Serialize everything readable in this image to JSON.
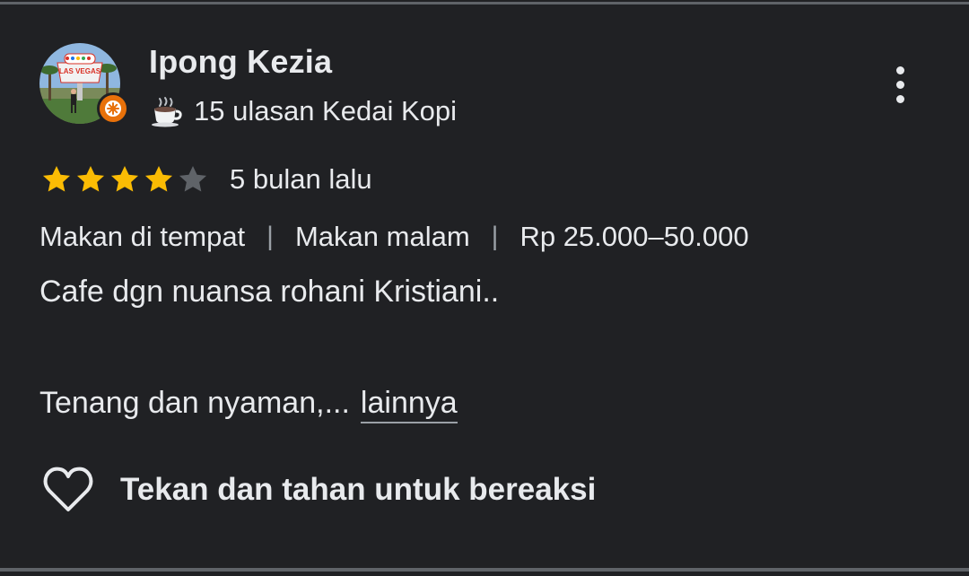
{
  "reviewer": {
    "name": "Ipong Kezia",
    "avatar_icon": "avatar-las-vegas-photo",
    "badge_icon": "local-guide-badge-icon",
    "badge_color": "#e8710a",
    "stats_icon": "coffee-cup-icon",
    "stats_text": "15 ulasan Kedai Kopi",
    "avatar_sign_text": "LAS VEGAS"
  },
  "rating": {
    "stars_filled": 4,
    "stars_total": 5,
    "star_color": "#fbbc04",
    "empty_star_color": "#5f6368",
    "time_ago": "5 bulan lalu"
  },
  "tags": {
    "service": "Makan di tempat",
    "meal": "Makan malam",
    "price": "Rp 25.000–50.000",
    "separator": "|"
  },
  "review": {
    "line1": "Cafe dgn nuansa rohani Kristiani..",
    "line2": "Tenang dan nyaman,...",
    "more_label": "lainnya"
  },
  "reaction": {
    "icon": "heart-outline-icon",
    "label": "Tekan dan tahan untuk bereaksi"
  },
  "menu": {
    "icon": "more-vertical-icon"
  },
  "colors": {
    "background": "#202124",
    "text": "#e8eaed",
    "divider": "#5f6368"
  }
}
